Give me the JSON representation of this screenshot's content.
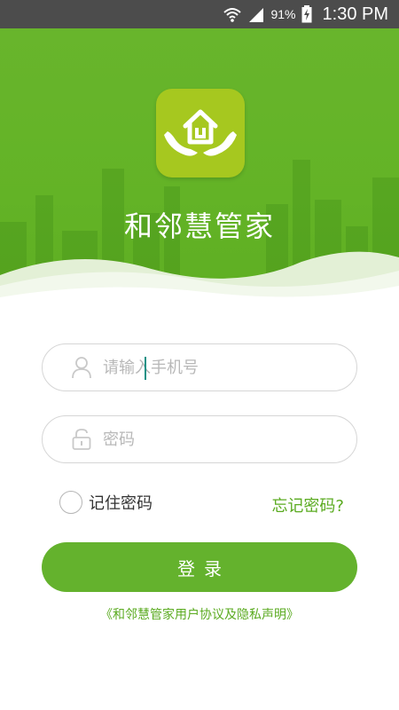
{
  "status_bar": {
    "battery_percent": "91%",
    "time": "1:30 PM",
    "icons": [
      "wifi-icon",
      "signal-icon",
      "battery-charging-icon"
    ]
  },
  "header": {
    "app_name": "和邻慧管家",
    "logo_icon": "house-in-hands-icon"
  },
  "form": {
    "phone": {
      "placeholder": "请输入手机号",
      "value": "",
      "icon": "user-icon"
    },
    "password": {
      "placeholder": "密码",
      "value": "",
      "icon": "lock-icon"
    },
    "remember_label": "记住密码",
    "remember_checked": false,
    "forgot_label": "忘记密码?",
    "login_label": "登录"
  },
  "footer": {
    "agreement_link": "《和邻慧管家用户协议及隐私声明》"
  },
  "colors": {
    "brand_green": "#64b22d",
    "logo_green": "#a6c81f",
    "status_bar": "#4c4c4c",
    "link_green": "#5bab21"
  }
}
